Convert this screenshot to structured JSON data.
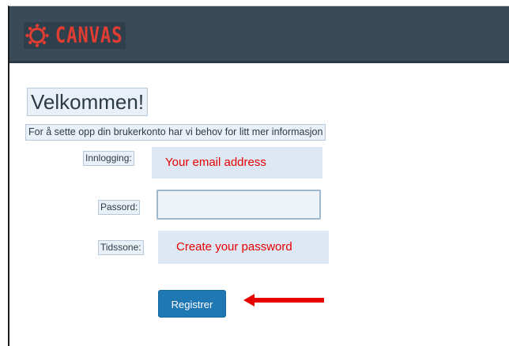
{
  "header": {
    "logo_text": "CANVAS",
    "logo_icon": "canvas-logo-icon",
    "background_color": "#394b58",
    "logo_color": "#e23d33"
  },
  "page": {
    "title": "Velkommen!",
    "subtitle": "For å sette opp din brukerkonto har vi behov for litt mer informasjon"
  },
  "form": {
    "login_label": "Innlogging:",
    "password_label": "Passord:",
    "timezone_label": "Tidssone:",
    "login_overlay_text": "Your email address",
    "timezone_overlay_text": "Create your password",
    "password_value": "",
    "register_label": "Registrer",
    "button_color": "#1f78b4"
  },
  "annotations": {
    "arrow_icon": "left-arrow-icon",
    "annotation_color": "#e60000"
  }
}
